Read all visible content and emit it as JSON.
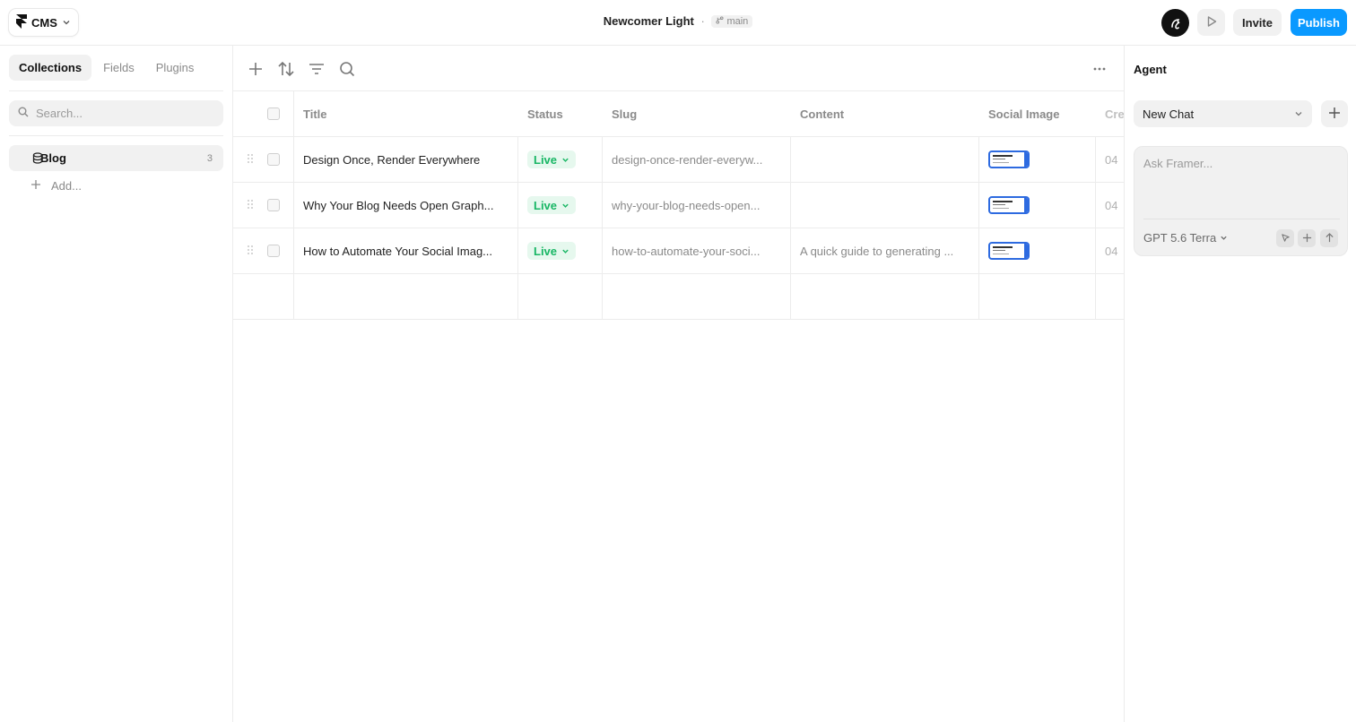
{
  "app": {
    "menu_label": "CMS",
    "project_name": "Newcomer Light",
    "separator": "·",
    "branch": "main",
    "invite_label": "Invite",
    "publish_label": "Publish",
    "accent_color": "#0a99ff"
  },
  "sidebar": {
    "tabs": [
      {
        "label": "Collections",
        "active": true
      },
      {
        "label": "Fields",
        "active": false
      },
      {
        "label": "Plugins",
        "active": false
      }
    ],
    "search_placeholder": "Search...",
    "collections": [
      {
        "name": "Blog",
        "count": "3",
        "icon": "database-icon"
      }
    ],
    "add_label": "Add..."
  },
  "table": {
    "columns": [
      "Title",
      "Status",
      "Slug",
      "Content",
      "Social Image",
      "Cre"
    ],
    "rows": [
      {
        "title": "Design Once, Render Everywhere",
        "status": "Live",
        "slug": "design-once-render-everyw...",
        "content": "",
        "date": "04"
      },
      {
        "title": "Why Your Blog Needs Open Graph...",
        "status": "Live",
        "slug": "why-your-blog-needs-open...",
        "content": "",
        "date": "04"
      },
      {
        "title": "How to Automate Your Social Imag...",
        "status": "Live",
        "slug": "how-to-automate-your-soci...",
        "content": "A quick guide to generating ...",
        "date": "04"
      }
    ],
    "status_color": "#18b664"
  },
  "agent": {
    "title": "Agent",
    "chat_select": "New Chat",
    "prompt_placeholder": "Ask Framer...",
    "model": "GPT 5.6 Terra"
  }
}
